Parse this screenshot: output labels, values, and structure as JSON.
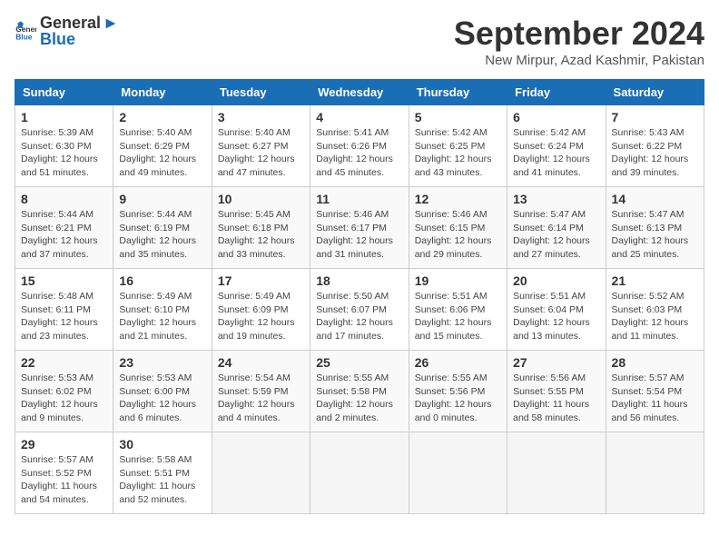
{
  "header": {
    "logo_general": "General",
    "logo_blue": "Blue",
    "title": "September 2024",
    "location": "New Mirpur, Azad Kashmir, Pakistan"
  },
  "columns": [
    "Sunday",
    "Monday",
    "Tuesday",
    "Wednesday",
    "Thursday",
    "Friday",
    "Saturday"
  ],
  "weeks": [
    [
      {
        "day": "1",
        "sunrise": "Sunrise: 5:39 AM",
        "sunset": "Sunset: 6:30 PM",
        "daylight": "Daylight: 12 hours and 51 minutes."
      },
      {
        "day": "2",
        "sunrise": "Sunrise: 5:40 AM",
        "sunset": "Sunset: 6:29 PM",
        "daylight": "Daylight: 12 hours and 49 minutes."
      },
      {
        "day": "3",
        "sunrise": "Sunrise: 5:40 AM",
        "sunset": "Sunset: 6:27 PM",
        "daylight": "Daylight: 12 hours and 47 minutes."
      },
      {
        "day": "4",
        "sunrise": "Sunrise: 5:41 AM",
        "sunset": "Sunset: 6:26 PM",
        "daylight": "Daylight: 12 hours and 45 minutes."
      },
      {
        "day": "5",
        "sunrise": "Sunrise: 5:42 AM",
        "sunset": "Sunset: 6:25 PM",
        "daylight": "Daylight: 12 hours and 43 minutes."
      },
      {
        "day": "6",
        "sunrise": "Sunrise: 5:42 AM",
        "sunset": "Sunset: 6:24 PM",
        "daylight": "Daylight: 12 hours and 41 minutes."
      },
      {
        "day": "7",
        "sunrise": "Sunrise: 5:43 AM",
        "sunset": "Sunset: 6:22 PM",
        "daylight": "Daylight: 12 hours and 39 minutes."
      }
    ],
    [
      {
        "day": "8",
        "sunrise": "Sunrise: 5:44 AM",
        "sunset": "Sunset: 6:21 PM",
        "daylight": "Daylight: 12 hours and 37 minutes."
      },
      {
        "day": "9",
        "sunrise": "Sunrise: 5:44 AM",
        "sunset": "Sunset: 6:19 PM",
        "daylight": "Daylight: 12 hours and 35 minutes."
      },
      {
        "day": "10",
        "sunrise": "Sunrise: 5:45 AM",
        "sunset": "Sunset: 6:18 PM",
        "daylight": "Daylight: 12 hours and 33 minutes."
      },
      {
        "day": "11",
        "sunrise": "Sunrise: 5:46 AM",
        "sunset": "Sunset: 6:17 PM",
        "daylight": "Daylight: 12 hours and 31 minutes."
      },
      {
        "day": "12",
        "sunrise": "Sunrise: 5:46 AM",
        "sunset": "Sunset: 6:15 PM",
        "daylight": "Daylight: 12 hours and 29 minutes."
      },
      {
        "day": "13",
        "sunrise": "Sunrise: 5:47 AM",
        "sunset": "Sunset: 6:14 PM",
        "daylight": "Daylight: 12 hours and 27 minutes."
      },
      {
        "day": "14",
        "sunrise": "Sunrise: 5:47 AM",
        "sunset": "Sunset: 6:13 PM",
        "daylight": "Daylight: 12 hours and 25 minutes."
      }
    ],
    [
      {
        "day": "15",
        "sunrise": "Sunrise: 5:48 AM",
        "sunset": "Sunset: 6:11 PM",
        "daylight": "Daylight: 12 hours and 23 minutes."
      },
      {
        "day": "16",
        "sunrise": "Sunrise: 5:49 AM",
        "sunset": "Sunset: 6:10 PM",
        "daylight": "Daylight: 12 hours and 21 minutes."
      },
      {
        "day": "17",
        "sunrise": "Sunrise: 5:49 AM",
        "sunset": "Sunset: 6:09 PM",
        "daylight": "Daylight: 12 hours and 19 minutes."
      },
      {
        "day": "18",
        "sunrise": "Sunrise: 5:50 AM",
        "sunset": "Sunset: 6:07 PM",
        "daylight": "Daylight: 12 hours and 17 minutes."
      },
      {
        "day": "19",
        "sunrise": "Sunrise: 5:51 AM",
        "sunset": "Sunset: 6:06 PM",
        "daylight": "Daylight: 12 hours and 15 minutes."
      },
      {
        "day": "20",
        "sunrise": "Sunrise: 5:51 AM",
        "sunset": "Sunset: 6:04 PM",
        "daylight": "Daylight: 12 hours and 13 minutes."
      },
      {
        "day": "21",
        "sunrise": "Sunrise: 5:52 AM",
        "sunset": "Sunset: 6:03 PM",
        "daylight": "Daylight: 12 hours and 11 minutes."
      }
    ],
    [
      {
        "day": "22",
        "sunrise": "Sunrise: 5:53 AM",
        "sunset": "Sunset: 6:02 PM",
        "daylight": "Daylight: 12 hours and 9 minutes."
      },
      {
        "day": "23",
        "sunrise": "Sunrise: 5:53 AM",
        "sunset": "Sunset: 6:00 PM",
        "daylight": "Daylight: 12 hours and 6 minutes."
      },
      {
        "day": "24",
        "sunrise": "Sunrise: 5:54 AM",
        "sunset": "Sunset: 5:59 PM",
        "daylight": "Daylight: 12 hours and 4 minutes."
      },
      {
        "day": "25",
        "sunrise": "Sunrise: 5:55 AM",
        "sunset": "Sunset: 5:58 PM",
        "daylight": "Daylight: 12 hours and 2 minutes."
      },
      {
        "day": "26",
        "sunrise": "Sunrise: 5:55 AM",
        "sunset": "Sunset: 5:56 PM",
        "daylight": "Daylight: 12 hours and 0 minutes."
      },
      {
        "day": "27",
        "sunrise": "Sunrise: 5:56 AM",
        "sunset": "Sunset: 5:55 PM",
        "daylight": "Daylight: 11 hours and 58 minutes."
      },
      {
        "day": "28",
        "sunrise": "Sunrise: 5:57 AM",
        "sunset": "Sunset: 5:54 PM",
        "daylight": "Daylight: 11 hours and 56 minutes."
      }
    ],
    [
      {
        "day": "29",
        "sunrise": "Sunrise: 5:57 AM",
        "sunset": "Sunset: 5:52 PM",
        "daylight": "Daylight: 11 hours and 54 minutes."
      },
      {
        "day": "30",
        "sunrise": "Sunrise: 5:58 AM",
        "sunset": "Sunset: 5:51 PM",
        "daylight": "Daylight: 11 hours and 52 minutes."
      },
      null,
      null,
      null,
      null,
      null
    ]
  ]
}
